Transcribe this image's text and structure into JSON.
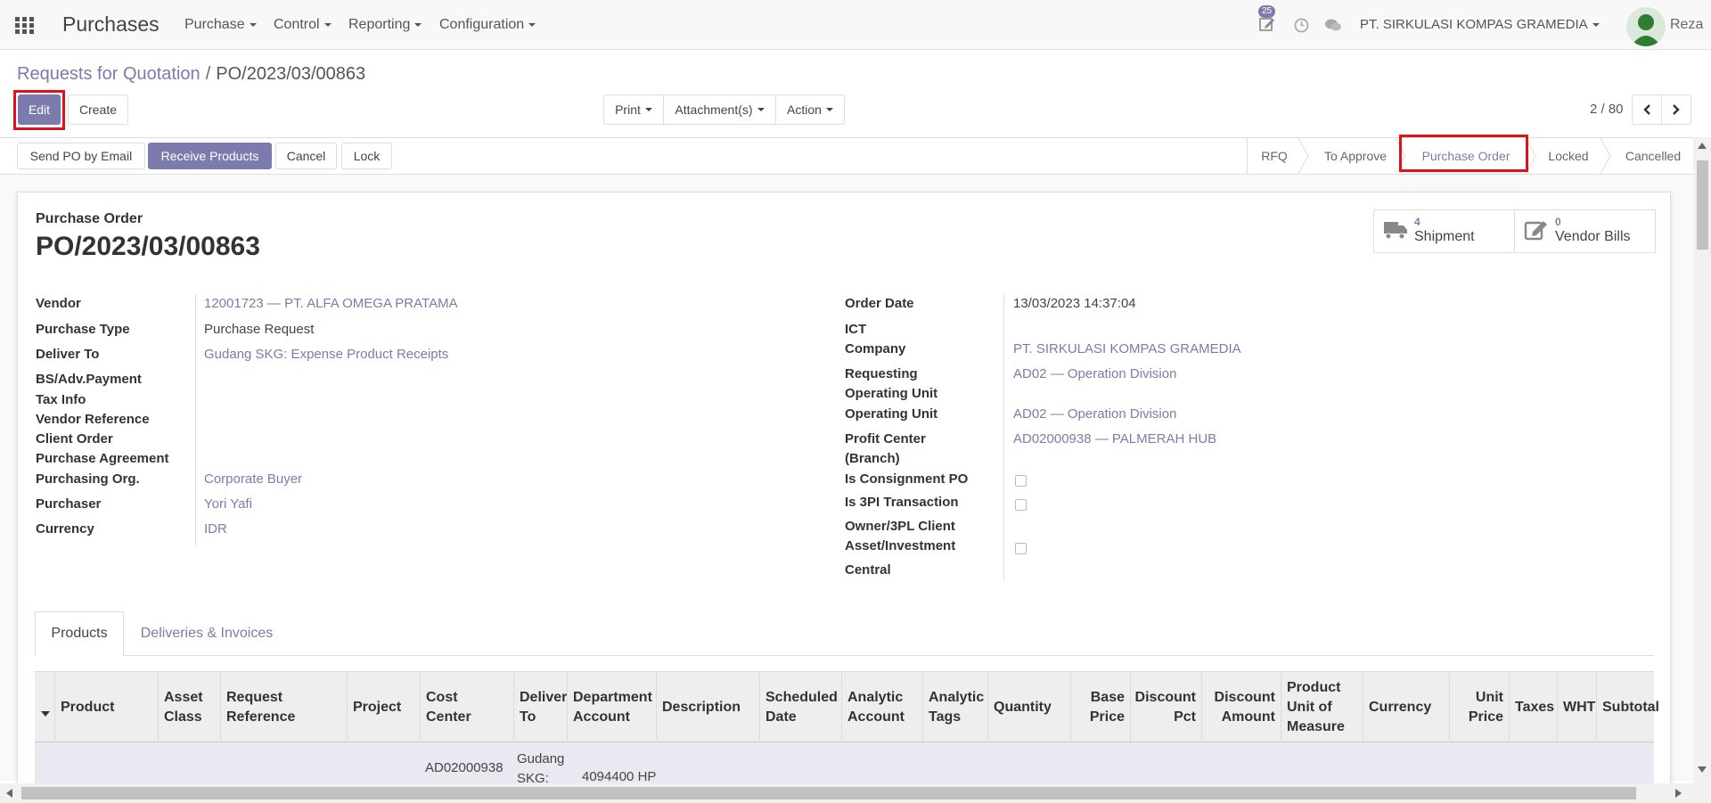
{
  "navbar": {
    "app_title": "Purchases",
    "menus": [
      "Purchase",
      "Control",
      "Reporting",
      "Configuration"
    ],
    "activity_count": "25",
    "company": "PT. SIRKULASI KOMPAS GRAMEDIA",
    "user": "Reza",
    "icons": [
      "apps-grid-icon",
      "activity-edit-icon",
      "clock-icon",
      "chat-icon"
    ]
  },
  "breadcrumb": {
    "parent": "Requests for Quotation",
    "separator": "/",
    "current": "PO/2023/03/00863"
  },
  "toolbar": {
    "edit": "Edit",
    "create": "Create",
    "print": "Print",
    "attachments": "Attachment(s)",
    "action": "Action",
    "pager": "2 / 80"
  },
  "status_actions": {
    "send_po": "Send PO by Email",
    "receive": "Receive Products",
    "cancel": "Cancel",
    "lock": "Lock"
  },
  "stages": {
    "rfq": "RFQ",
    "to_approve": "To Approve",
    "purchase_order": "Purchase Order",
    "locked": "Locked",
    "cancelled": "Cancelled",
    "active": "Purchase Order"
  },
  "header": {
    "doc_type": "Purchase Order",
    "doc_name": "PO/2023/03/00863"
  },
  "smart_buttons": {
    "shipment_count": "4",
    "shipment_label": "Shipment",
    "bills_count": "0",
    "bills_label": "Vendor Bills"
  },
  "left_fields": {
    "vendor_label": "Vendor",
    "vendor": "12001723 — PT. ALFA OMEGA PRATAMA",
    "purchase_type_label": "Purchase Type",
    "purchase_type": "Purchase Request",
    "deliver_to_label": "Deliver To",
    "deliver_to": "Gudang SKG: Expense Product Receipts",
    "bs_label": "BS/Adv.Payment",
    "tax_info_label": "Tax Info",
    "vendor_ref_label": "Vendor Reference",
    "client_order_label": "Client Order",
    "agreement_label": "Purchase Agreement",
    "purchasing_org_label": "Purchasing Org.",
    "purchasing_org": "Corporate Buyer",
    "purchaser_label": "Purchaser",
    "purchaser": "Yori Yafi",
    "currency_label": "Currency",
    "currency": "IDR"
  },
  "right_fields": {
    "order_date_label": "Order Date",
    "order_date": "13/03/2023 14:37:04",
    "ict_label": "ICT",
    "company_label": "Company",
    "company": "PT. SIRKULASI KOMPAS GRAMEDIA",
    "req_ou_label_1": "Requesting",
    "req_ou_label_2": "Operating Unit",
    "req_ou": "AD02 — Operation Division",
    "ou_label": "Operating Unit",
    "ou": "AD02 — Operation Division",
    "profit_center_label_1": "Profit Center",
    "profit_center_label_2": "(Branch)",
    "profit_center": "AD02000938 — PALMERAH HUB",
    "consignment_label": "Is Consignment PO",
    "tpl_label": "Is 3PI Transaction",
    "owner_label": "Owner/3PL Client",
    "asset_label": "Asset/Investment",
    "central_label": "Central"
  },
  "tabs": {
    "products": "Products",
    "deliveries": "Deliveries & Invoices"
  },
  "table": {
    "columns": [
      {
        "l1": "Product",
        "l2": "",
        "l3": ""
      },
      {
        "l1": "Asset",
        "l2": "Class",
        "l3": ""
      },
      {
        "l1": "Request",
        "l2": "Reference",
        "l3": ""
      },
      {
        "l1": "Project",
        "l2": "",
        "l3": ""
      },
      {
        "l1": "Cost",
        "l2": "Center",
        "l3": ""
      },
      {
        "l1": "Deliver",
        "l2": "To",
        "l3": ""
      },
      {
        "l1": "Department",
        "l2": "Account",
        "l3": ""
      },
      {
        "l1": "Description",
        "l2": "",
        "l3": ""
      },
      {
        "l1": "Scheduled",
        "l2": "Date",
        "l3": ""
      },
      {
        "l1": "Analytic",
        "l2": "Account",
        "l3": ""
      },
      {
        "l1": "Analytic",
        "l2": "Tags",
        "l3": ""
      },
      {
        "l1": "Quantity",
        "l2": "",
        "l3": ""
      },
      {
        "l1": "Base",
        "l2": "Price",
        "l3": ""
      },
      {
        "l1": "Discount",
        "l2": "Pct",
        "l3": ""
      },
      {
        "l1": "Discount",
        "l2": "Amount",
        "l3": ""
      },
      {
        "l1": "Product",
        "l2": "Unit of",
        "l3": "Measure"
      },
      {
        "l1": "Currency",
        "l2": "",
        "l3": ""
      },
      {
        "l1": "Unit",
        "l2": "Price",
        "l3": ""
      },
      {
        "l1": "Taxes",
        "l2": "",
        "l3": ""
      },
      {
        "l1": "WHT",
        "l2": "",
        "l3": ""
      },
      {
        "l1": "Subtotal",
        "l2": "",
        "l3": ""
      }
    ],
    "row1": {
      "cost_center": "AD02000938",
      "deliver_to_1": "Gudang",
      "deliver_to_2": "SKG:",
      "department_account": "4094400 HP"
    }
  }
}
